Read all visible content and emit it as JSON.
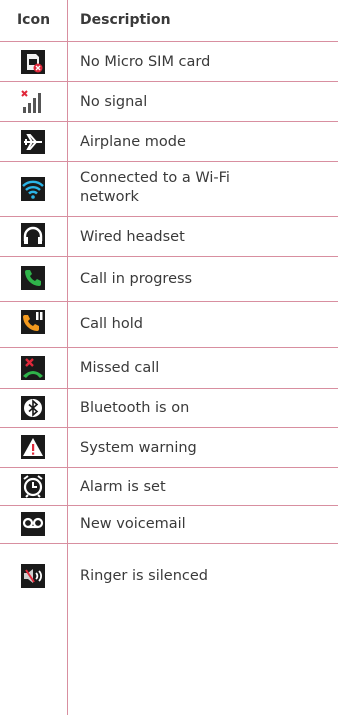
{
  "header": {
    "icon": "Icon",
    "description": "Description"
  },
  "rows": [
    {
      "icon": "no-sim-icon",
      "text": "No Micro SIM card"
    },
    {
      "icon": "no-signal-icon",
      "text": "No signal"
    },
    {
      "icon": "airplane-icon",
      "text": "Airplane mode"
    },
    {
      "icon": "wifi-icon",
      "text": "Connected to a Wi-Fi network"
    },
    {
      "icon": "headset-icon",
      "text": "Wired headset"
    },
    {
      "icon": "call-icon",
      "text": "Call in progress"
    },
    {
      "icon": "call-hold-icon",
      "text": "Call hold"
    },
    {
      "icon": "missed-call-icon",
      "text": "Missed call"
    },
    {
      "icon": "bluetooth-icon",
      "text": "Bluetooth is on"
    },
    {
      "icon": "warning-icon",
      "text": "System warning"
    },
    {
      "icon": "alarm-icon",
      "text": "Alarm is set"
    },
    {
      "icon": "voicemail-icon",
      "text": "New voicemail"
    },
    {
      "icon": "ringer-silenced-icon",
      "text": "Ringer is silenced"
    }
  ],
  "colors": {
    "rule": "#d88fa0",
    "text": "#3a3a3a",
    "icon_bg": "#111111",
    "green": "#2fb34a",
    "red": "#e0283a",
    "wifi": "#2bb5e8"
  }
}
